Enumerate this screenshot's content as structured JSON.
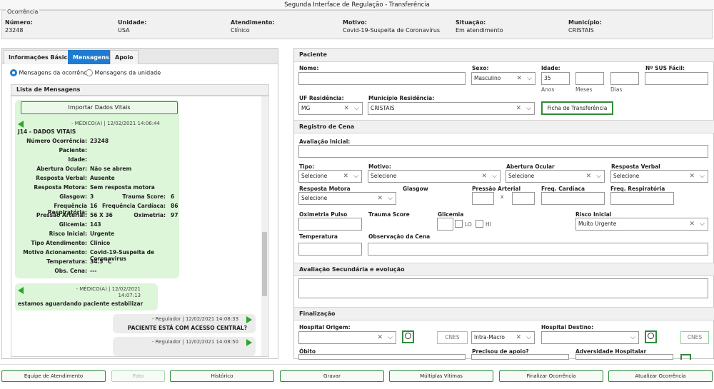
{
  "window_title": "Segunda Interface de Regulação - Transferência",
  "occurrence": {
    "legend": "Ocorrência",
    "fields": [
      {
        "label": "Número:",
        "value": "23248"
      },
      {
        "label": "Unidade:",
        "value": "USA"
      },
      {
        "label": "Atendimento:",
        "value": "Clínico"
      },
      {
        "label": "Motivo:",
        "value": "Covid-19-Suspeita de Coronavírus"
      },
      {
        "label": "Situação:",
        "value": "Em atendimento"
      },
      {
        "label": "Município:",
        "value": "CRISTAIS"
      }
    ]
  },
  "left_tabs": [
    "Informações Básicas",
    "Mensagens",
    "Apoio"
  ],
  "active_tab": "Mensagens",
  "radios": {
    "occurrence": "Mensagens da ocorrência",
    "unit": "Mensagens da unidade",
    "selected": "occurrence"
  },
  "list_header": "Lista de Mensagens",
  "import_button": "Importar Dados Vitais",
  "msg1": {
    "sender": "- MÉDICO(A) | 12/02/2021 14:06:44",
    "title": "J14 - DADOS VITAIS",
    "lines": [
      {
        "label": "Número Ocorrência:",
        "value": "23248"
      },
      {
        "label": "Paciente:",
        "value": ""
      },
      {
        "label": "Idade:",
        "value": ""
      },
      {
        "label": "Abertura Ocular:",
        "value": "Não se abrem"
      },
      {
        "label": "Resposta Verbal:",
        "value": "Ausente"
      },
      {
        "label": "Resposta Motora:",
        "value": "Sem resposta motora"
      }
    ],
    "pairs": [
      {
        "l1": "Glasgow:",
        "v1": "3",
        "l2": "Trauma Score:",
        "v2": "6"
      },
      {
        "l1": "Frequência Respiratória:",
        "v1": "16",
        "l2": "Frequência Cardíaca:",
        "v2": "86"
      },
      {
        "l1": "Pressão Arterial:",
        "v1": "56 X 36",
        "l2": "Oximetria:",
        "v2": "97"
      }
    ],
    "lines2": [
      {
        "label": "Glicemia:",
        "value": "143"
      },
      {
        "label": "Risco Inicial:",
        "value": "Urgente"
      },
      {
        "label": "Tipo Atendimento:",
        "value": "Clinico"
      },
      {
        "label": "Motivo Acionamento:",
        "value": "Covid-19-Suspeita de Coronavirus"
      },
      {
        "label": "Temperatura:",
        "value": "34.5 °C"
      },
      {
        "label": "Obs. Cena:",
        "value": "---"
      }
    ]
  },
  "msg2": {
    "sender": "- MÉDICO(A) | 12/02/2021",
    "time": "14:07:13",
    "text": "estamos aguardando paciente estabilizar"
  },
  "msg3": {
    "sender": "- Regulador | 12/02/2021 14:08:33",
    "text": "PACIENTE ESTÁ COM ACESSO CENTRAL?"
  },
  "msg4": {
    "sender": "- Regulador | 12/02/2021 14:08:50"
  },
  "paciente": {
    "section": "Paciente",
    "nome_label": "Nome:",
    "sexo_label": "Sexo:",
    "sexo_value": "Masculino",
    "idade_label": "Idade:",
    "idade_anos": "35",
    "anos": "Anos",
    "meses": "Meses",
    "dias": "Dias",
    "sus_label": "Nº SUS Fácil:",
    "uf_label": "UF Residência:",
    "uf_value": "MG",
    "mun_label": "Município Residência:",
    "mun_value": "CRISTAIS",
    "ficha_button": "Ficha de Transferência"
  },
  "cena": {
    "section": "Registro de Cena",
    "aval_label": "Avaliação Inicial:",
    "tipo_label": "Tipo:",
    "motivo_label": "Motivo:",
    "abertura_label": "Abertura Ocular",
    "verbal_label": "Resposta Verbal",
    "select_placeholder": "Selecione",
    "motora_label": "Resposta Motora",
    "glasgow_label": "Glasgow",
    "pressao_label": "Pressão Arterial",
    "x": "x",
    "freqc_label": "Freq. Cardíaca",
    "freqr_label": "Freq. Respiratória",
    "oxi_label": "Oximetria Pulso",
    "trauma_label": "Trauma Score",
    "glicemia_label": "Glicemia",
    "lo": "LO",
    "hi": "HI",
    "risco_label": "Risco Inicial",
    "risco_value": "Muito Urgente",
    "temp_label": "Temperatura",
    "obs_label": "Observação da Cena"
  },
  "avaliacao_sec": "Avaliação Secundária e evolução",
  "finalizacao": {
    "section": "Finalização",
    "origem_label": "Hospital Origem:",
    "cnes": "CNES",
    "intra": "Intra-Macro",
    "destino_label": "Hospital Destino:",
    "obito_label": "Óbito",
    "apoio_label": "Precisou de apoio?",
    "advers_label": "Adversidade Hospitalar"
  },
  "footer_buttons": [
    "Equipe de Atendimento",
    "Foto",
    "Histórico",
    "Gravar",
    "Múltiplas Vítimas",
    "Finalizar Ocorrência",
    "Atualizar Ocorrência"
  ],
  "colors": {
    "accent": "#1f7bcf",
    "green": "#2e8b3a",
    "msg_bg": "#ddf5d9"
  }
}
